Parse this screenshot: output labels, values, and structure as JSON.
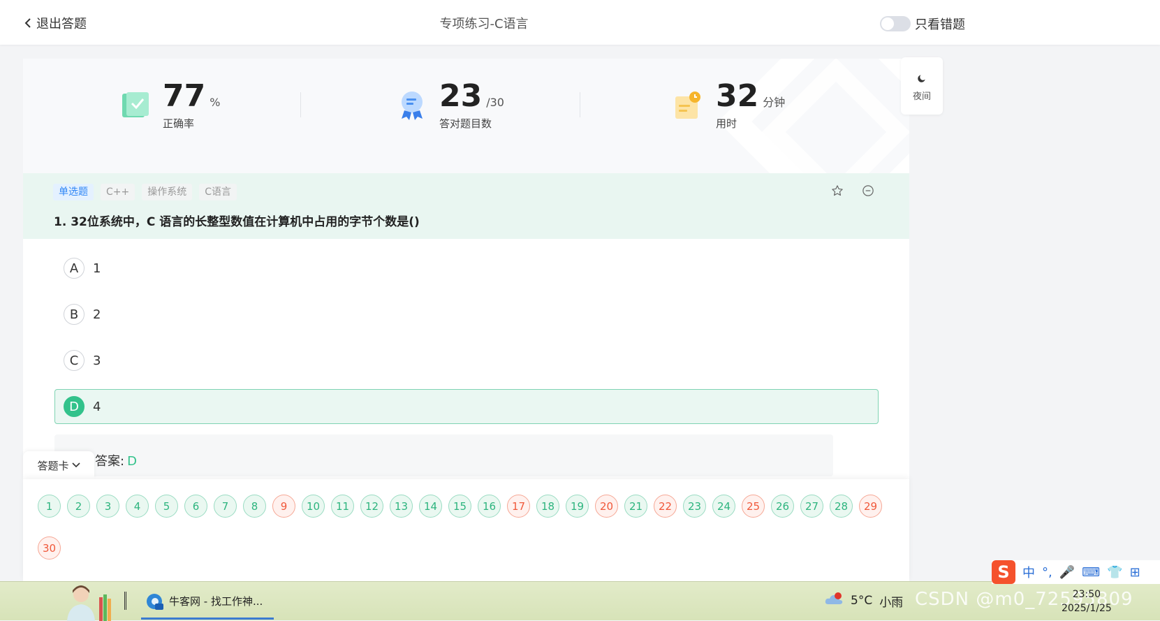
{
  "header": {
    "back_label": "退出答题",
    "title": "专项练习-C语言",
    "mistakes_only_label": "只看错题"
  },
  "stats": {
    "accuracy": {
      "value": "77",
      "unit": "%",
      "label": "正确率"
    },
    "correct_count": {
      "value": "23",
      "unit": "/30",
      "label": "答对题目数"
    },
    "time": {
      "value": "32",
      "unit": "分钟",
      "label": "用时"
    }
  },
  "night_mode": {
    "label": "夜间"
  },
  "question": {
    "tags": [
      "单选题",
      "C++",
      "操作系统",
      "C语言"
    ],
    "text": "1. 32位系统中，C 语言的长整型数值在计算机中占用的字节个数是()",
    "options": [
      {
        "letter": "A",
        "text": "1"
      },
      {
        "letter": "B",
        "text": "2"
      },
      {
        "letter": "C",
        "text": "3"
      },
      {
        "letter": "D",
        "text": "4"
      }
    ],
    "selected": "D",
    "answer_label": "答案:",
    "answer_value": "D"
  },
  "answer_sheet": {
    "tab_label": "答题卡",
    "numbers": [
      {
        "n": "1",
        "status": "correct"
      },
      {
        "n": "2",
        "status": "correct"
      },
      {
        "n": "3",
        "status": "correct"
      },
      {
        "n": "4",
        "status": "correct"
      },
      {
        "n": "5",
        "status": "correct"
      },
      {
        "n": "6",
        "status": "correct"
      },
      {
        "n": "7",
        "status": "correct"
      },
      {
        "n": "8",
        "status": "correct"
      },
      {
        "n": "9",
        "status": "wrong"
      },
      {
        "n": "10",
        "status": "correct"
      },
      {
        "n": "11",
        "status": "correct"
      },
      {
        "n": "12",
        "status": "correct"
      },
      {
        "n": "13",
        "status": "correct"
      },
      {
        "n": "14",
        "status": "correct"
      },
      {
        "n": "15",
        "status": "correct"
      },
      {
        "n": "16",
        "status": "correct"
      },
      {
        "n": "17",
        "status": "wrong"
      },
      {
        "n": "18",
        "status": "correct"
      },
      {
        "n": "19",
        "status": "correct"
      },
      {
        "n": "20",
        "status": "wrong"
      },
      {
        "n": "21",
        "status": "correct"
      },
      {
        "n": "22",
        "status": "wrong"
      },
      {
        "n": "23",
        "status": "correct"
      },
      {
        "n": "24",
        "status": "correct"
      },
      {
        "n": "25",
        "status": "wrong"
      },
      {
        "n": "26",
        "status": "correct"
      },
      {
        "n": "27",
        "status": "correct"
      },
      {
        "n": "28",
        "status": "correct"
      },
      {
        "n": "29",
        "status": "wrong"
      },
      {
        "n": "30",
        "status": "wrong"
      }
    ]
  },
  "taskbar": {
    "app_title": "牛客网 - 找工作神...",
    "weather_temp": "5°C",
    "weather_desc": "小雨",
    "watermark": "CSDN @m0_72595809",
    "time": "23:50",
    "date": "2025/1/25",
    "ime_items": [
      "中",
      "°,",
      "🎤",
      "⌨",
      "👕",
      "⊞"
    ]
  },
  "colors": {
    "accent_green": "#32c28b",
    "wrong_red": "#f0583a",
    "tag_blue": "#2f86f6"
  }
}
